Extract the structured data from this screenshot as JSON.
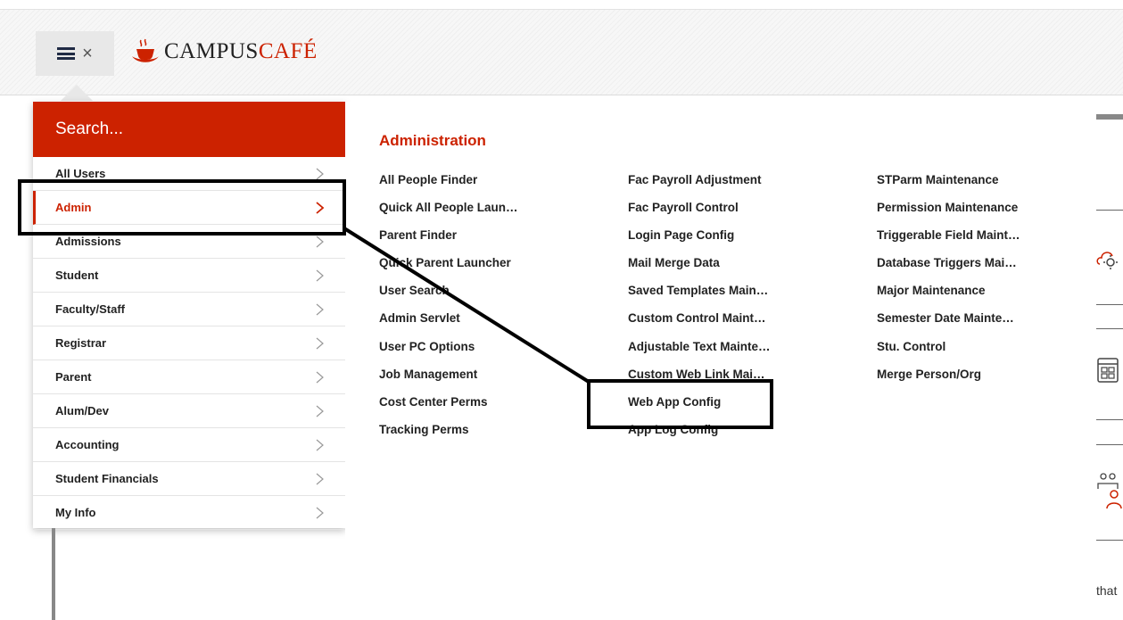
{
  "header": {
    "logo": {
      "part1": "CAMPUS",
      "part2": "CAFÉ"
    }
  },
  "search": {
    "placeholder": "Search..."
  },
  "menu": {
    "items": [
      {
        "label": "All Users",
        "active": false
      },
      {
        "label": "Admin",
        "active": true
      },
      {
        "label": "Admissions",
        "active": false
      },
      {
        "label": "Student",
        "active": false
      },
      {
        "label": "Faculty/Staff",
        "active": false
      },
      {
        "label": "Registrar",
        "active": false
      },
      {
        "label": "Parent",
        "active": false
      },
      {
        "label": "Alum/Dev",
        "active": false
      },
      {
        "label": "Accounting",
        "active": false
      },
      {
        "label": "Student Financials",
        "active": false
      },
      {
        "label": "My Info",
        "active": false
      }
    ]
  },
  "mega": {
    "title": "Administration",
    "columns": [
      [
        "All People Finder",
        "Quick All People Laun…",
        "Parent Finder",
        "Quick Parent Launcher",
        "User Search",
        "Admin Servlet",
        "User PC Options",
        "Job Management",
        "Cost Center Perms",
        "Tracking Perms"
      ],
      [
        "Fac Payroll Adjustment",
        "Fac Payroll Control",
        "Login Page Config",
        "Mail Merge Data",
        "Saved Templates Main…",
        "Custom Control Maint…",
        "Adjustable Text Mainte…",
        "Custom Web Link Mai…",
        "Web App Config",
        "App Log Config"
      ],
      [
        "STParm Maintenance",
        "Permission Maintenance",
        "Triggerable Field Maint…",
        "Database Triggers Mai…",
        "Major Maintenance",
        "Semester Date Mainte…",
        "Stu. Control",
        "Merge Person/Org"
      ]
    ]
  },
  "right": {
    "tail_text": "that"
  },
  "colors": {
    "brand_red": "#cc2200",
    "text": "#222222",
    "toggle_bg": "#e8e8e8"
  }
}
